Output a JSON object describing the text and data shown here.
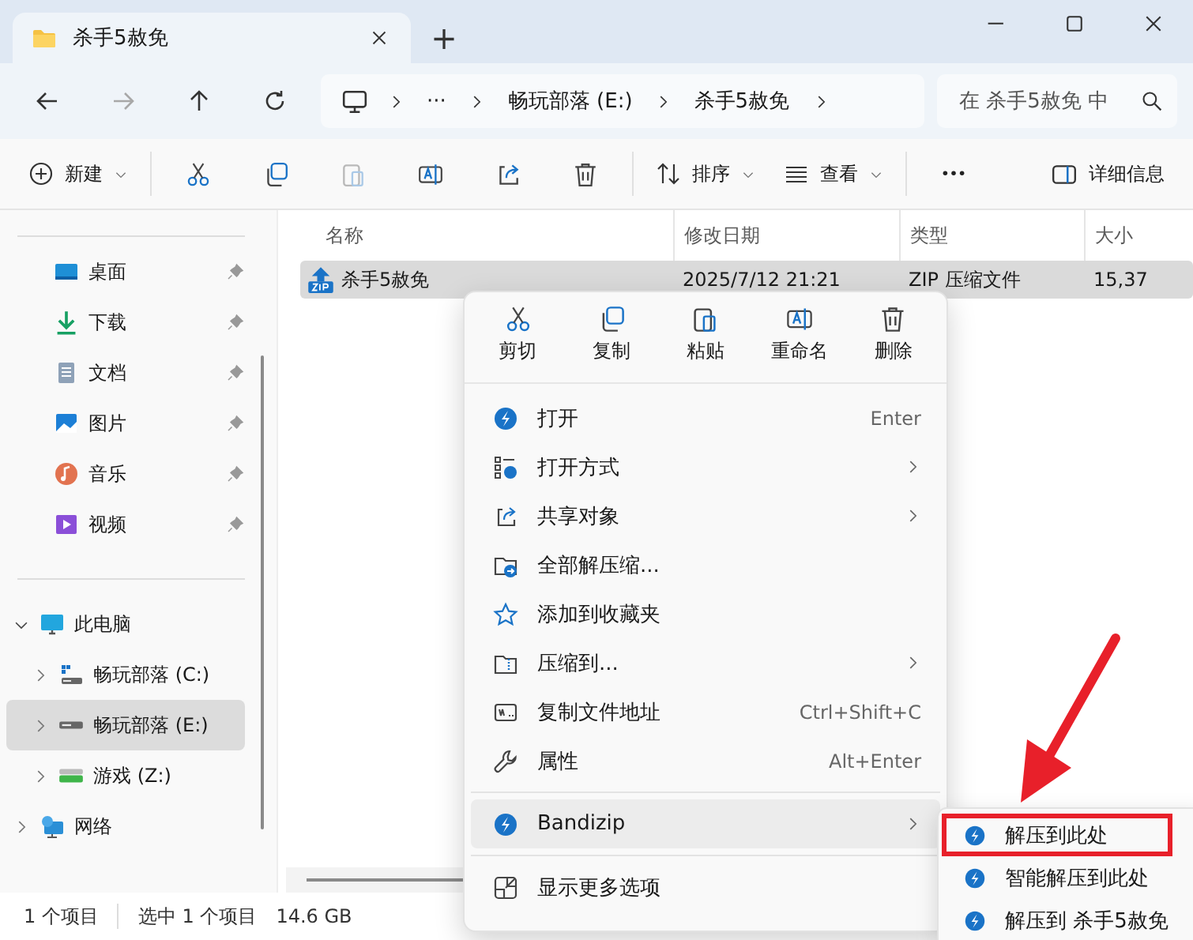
{
  "window": {
    "tab_title": "杀手5赦免",
    "new_tab": "+"
  },
  "nav": {
    "buttons": [
      {
        "disabled": false
      },
      {
        "disabled": true
      },
      {
        "disabled": false
      },
      {
        "disabled": false
      }
    ],
    "crumbs": [
      "···",
      "畅玩部落 (E:)",
      "杀手5赦免"
    ],
    "search": {
      "placeholder": "在 杀手5赦免 中"
    }
  },
  "toolbar": [
    {
      "kind": "menu",
      "label": "新建"
    },
    {
      "kind": "icon",
      "disabled": false
    },
    {
      "kind": "icon",
      "disabled": false
    },
    {
      "kind": "icon",
      "disabled": true
    },
    {
      "kind": "icon",
      "disabled": false
    },
    {
      "kind": "icon",
      "disabled": false
    },
    {
      "kind": "icon",
      "disabled": false
    },
    {
      "kind": "menu",
      "label": "排序"
    },
    {
      "kind": "menu",
      "label": "查看"
    },
    {
      "kind": "icon",
      "disabled": false
    },
    {
      "kind": "plain",
      "label": "详细信息"
    }
  ],
  "sidebar": {
    "quick_access": [
      {
        "label": "桌面"
      },
      {
        "label": "下载"
      },
      {
        "label": "文档"
      },
      {
        "label": "图片"
      },
      {
        "label": "音乐"
      },
      {
        "label": "视频"
      }
    ],
    "tree": [
      {
        "label": "此电脑",
        "expanded": true,
        "selected": false,
        "children": [
          {
            "label": "畅玩部落 (C:)",
            "expanded": false,
            "selected": false
          },
          {
            "label": "畅玩部落 (E:)",
            "expanded": false,
            "selected": true
          },
          {
            "label": "游戏 (Z:)",
            "expanded": false,
            "selected": false
          }
        ]
      },
      {
        "label": "网络",
        "expanded": false,
        "selected": false
      }
    ]
  },
  "files": {
    "columns": [
      "名称",
      "修改日期",
      "类型",
      "大小"
    ],
    "rows": [
      {
        "cells": [
          "杀手5赦免",
          "2025/7/12 21:21",
          "ZIP 压缩文件",
          "15,37"
        ],
        "selected": true
      }
    ]
  },
  "status_bar": [
    "1 个项目",
    "选中 1 个项目",
    "14.6 GB"
  ],
  "context_menu": {
    "actions": [
      {
        "label": "剪切"
      },
      {
        "label": "复制"
      },
      {
        "label": "粘贴"
      },
      {
        "label": "重命名"
      },
      {
        "label": "删除"
      }
    ],
    "items": [
      {
        "label": "打开",
        "shortcut": "Enter",
        "submenu": false,
        "highlighted": false
      },
      {
        "label": "打开方式",
        "submenu": true,
        "highlighted": false
      },
      {
        "label": "共享对象",
        "submenu": true,
        "highlighted": false
      },
      {
        "label": "全部解压缩...",
        "submenu": false,
        "highlighted": false
      },
      {
        "label": "添加到收藏夹",
        "submenu": false,
        "highlighted": false
      },
      {
        "label": "压缩到...",
        "submenu": true,
        "highlighted": false
      },
      {
        "label": "复制文件地址",
        "shortcut": "Ctrl+Shift+C",
        "submenu": false,
        "highlighted": false
      },
      {
        "label": "属性",
        "shortcut": "Alt+Enter",
        "submenu": false,
        "highlighted": false
      },
      {
        "kind": "separator"
      },
      {
        "label": "Bandizip",
        "submenu": true,
        "highlighted": true
      },
      {
        "kind": "separator"
      },
      {
        "label": "显示更多选项",
        "submenu": false,
        "highlighted": false
      }
    ]
  },
  "submenu": [
    {
      "label": "解压到此处",
      "marked": true
    },
    {
      "label": "智能解压到此处",
      "marked": false
    },
    {
      "label": "解压到 杀手5赦免",
      "marked": false
    }
  ]
}
